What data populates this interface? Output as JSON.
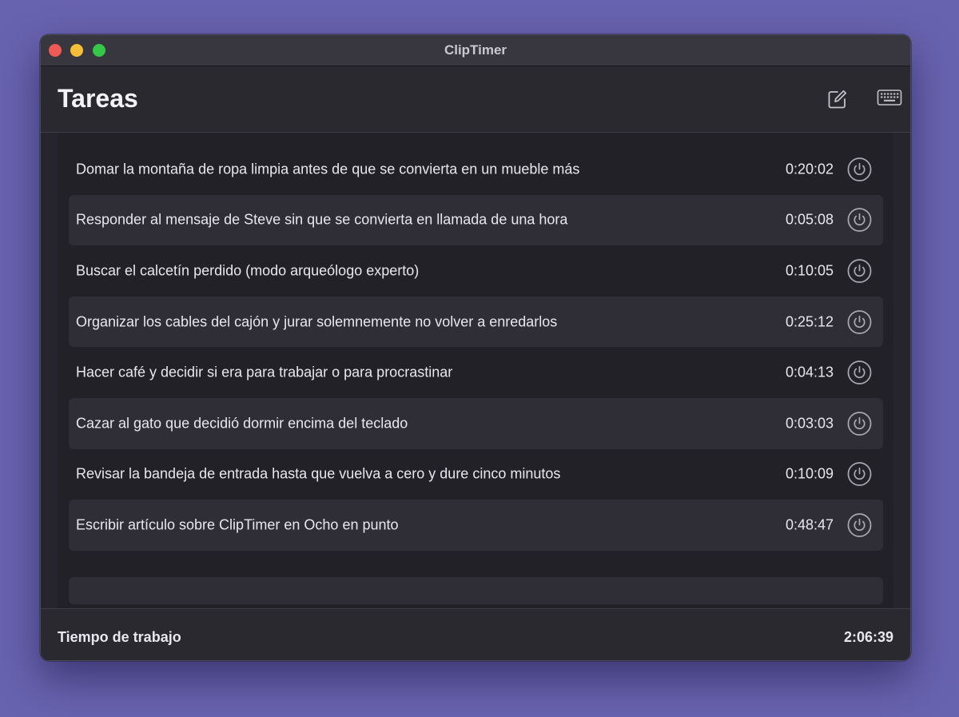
{
  "window": {
    "title": "ClipTimer"
  },
  "header": {
    "title": "Tareas",
    "icons": [
      "compose-icon",
      "keyboard-icon"
    ]
  },
  "tasks": [
    {
      "name": "Domar la montaña de ropa limpia antes de que se convierta en un mueble más",
      "time": "0:20:02"
    },
    {
      "name": "Responder al mensaje de Steve sin que se convierta en llamada de una hora",
      "time": "0:05:08"
    },
    {
      "name": "Buscar el calcetín perdido (modo arqueólogo experto)",
      "time": "0:10:05"
    },
    {
      "name": "Organizar los cables del cajón y jurar solemnemente no volver a enredarlos",
      "time": "0:25:12"
    },
    {
      "name": "Hacer café y decidir si era para trabajar o para procrastinar",
      "time": "0:04:13"
    },
    {
      "name": "Cazar al gato que decidió dormir encima del teclado",
      "time": "0:03:03"
    },
    {
      "name": "Revisar la bandeja de entrada hasta que vuelva a cero y dure cinco minutos",
      "time": "0:10:09"
    },
    {
      "name": "Escribir artículo sobre ClipTimer en Ocho en punto",
      "time": "0:48:47"
    }
  ],
  "footer": {
    "label": "Tiempo de trabajo",
    "total": "2:06:39"
  },
  "colors": {
    "desktop": "#6863ae",
    "window_bg": "#26252d",
    "row_alt": "#2f2e36",
    "text": "#e8e7ed",
    "close": "#ee5a55",
    "minimize": "#f5bd38",
    "maximize": "#34c748"
  }
}
